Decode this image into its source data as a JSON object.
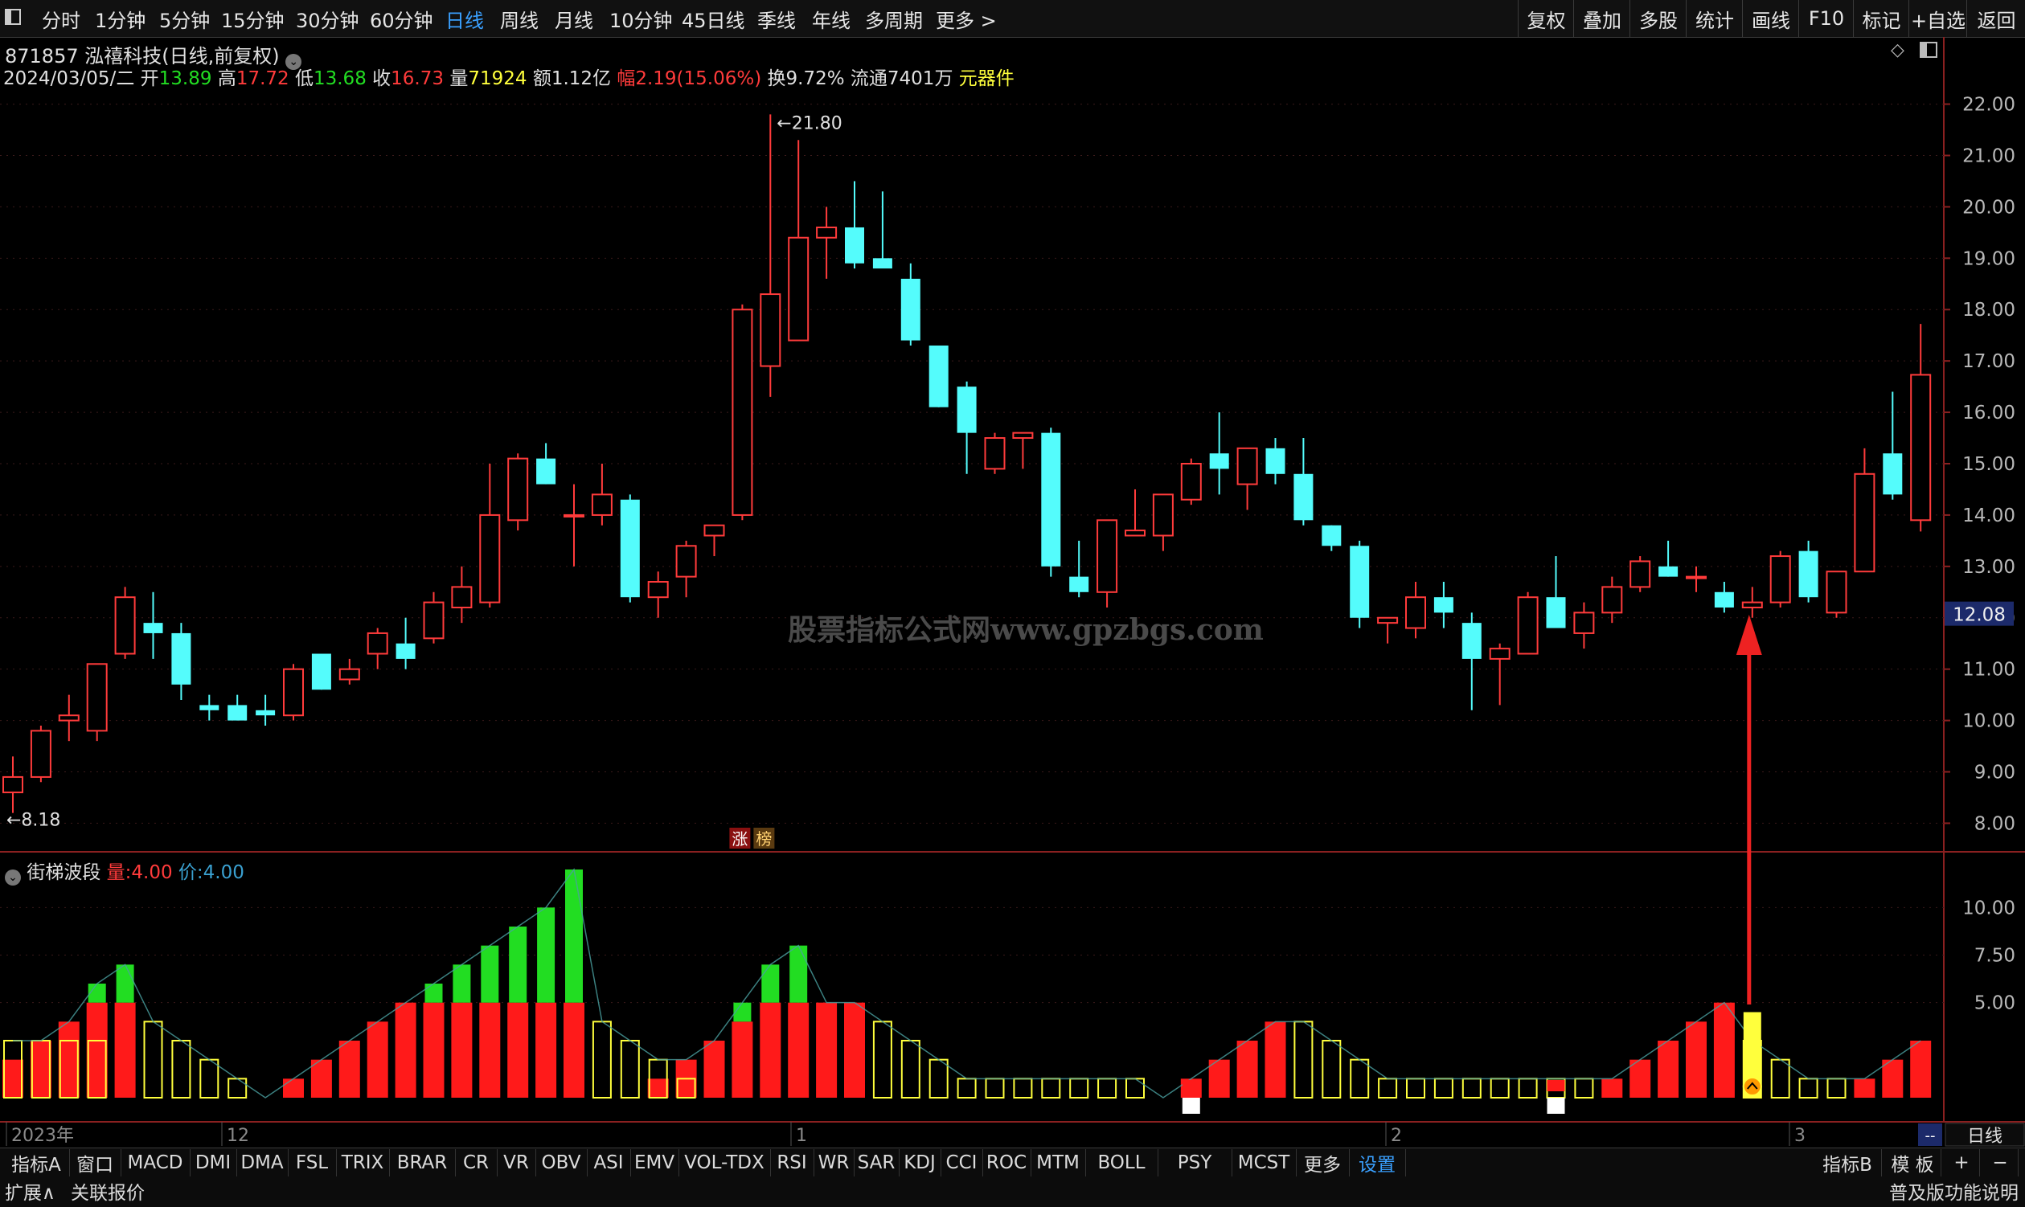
{
  "toolbar": {
    "timeframes": [
      "分时",
      "1分钟",
      "5分钟",
      "15分钟",
      "30分钟",
      "60分钟",
      "日线",
      "周线",
      "月线",
      "10分钟",
      "45日线",
      "季线",
      "年线",
      "多周期",
      "更多 >"
    ],
    "active_index": 6,
    "right_buttons": [
      "复权",
      "叠加",
      "多股",
      "统计",
      "画线",
      "F10",
      "标记",
      "+自选",
      "返回"
    ]
  },
  "stock": {
    "code_name": "871857 泓禧科技(日线,前复权)",
    "date": "2024/03/05/二",
    "open_label": "开",
    "open": "13.89",
    "high_label": "高",
    "high": "17.72",
    "low_label": "低",
    "low": "13.68",
    "close_label": "收",
    "close": "16.73",
    "vol_label": "量",
    "vol": "71924",
    "amount_label": "额",
    "amount": "1.12亿",
    "change_label": "幅",
    "change": "2.19(15.06%)",
    "turnover": "换9.72%",
    "float": "流通7401万",
    "sector": "元器件"
  },
  "price_axis": [
    "22.00",
    "21.00",
    "20.00",
    "19.00",
    "18.00",
    "17.00",
    "16.00",
    "15.00",
    "14.00",
    "13.00",
    "12.00",
    "11.00",
    "10.00",
    "9.00",
    "8.00"
  ],
  "current_price_tag": "12.08",
  "markers": {
    "max_label": "21.80",
    "min_label": "8.18",
    "zhang": "涨",
    "bang": "榜"
  },
  "watermark": "股票指标公式网www.gpzbgs.com",
  "indicator": {
    "name": "街梯波段",
    "vol_label": "量:",
    "vol_value": "4.00",
    "price_label": "价:",
    "price_value": "4.00",
    "axis": [
      "10.00",
      "7.50",
      "5.00"
    ]
  },
  "date_axis": [
    "2023年",
    "12",
    "1",
    "2",
    "3"
  ],
  "axis_minus": "--",
  "period_box": "日线",
  "tabs": [
    "指标A",
    "窗口",
    "MACD",
    "DMI",
    "DMA",
    "FSL",
    "TRIX",
    "BRAR",
    "CR",
    "VR",
    "OBV",
    "ASI",
    "EMV",
    "VOL-TDX",
    "RSI",
    "WR",
    "SAR",
    "KDJ",
    "CCI",
    "ROC",
    "MTM",
    "BOLL",
    "PSY",
    "MCST",
    "更多",
    "设置"
  ],
  "tabs_highlight": "设置",
  "tabs_right": [
    "指标B",
    "模 板",
    "+",
    "−"
  ],
  "bottom_left": [
    "扩展∧",
    "关联报价"
  ],
  "bottom_right": "普及版功能说明",
  "colors": {
    "up": "#ff3b3b",
    "down": "#54fcfc",
    "green": "#22dd22",
    "yellow": "#ffff3c",
    "accent": "#3aa0ff"
  },
  "chart_data": {
    "type": "candlestick",
    "candles": [
      [
        8.6,
        9.3,
        8.2,
        8.9
      ],
      [
        8.9,
        9.9,
        8.8,
        9.8
      ],
      [
        10.0,
        10.5,
        9.6,
        10.1
      ],
      [
        9.8,
        11.1,
        9.6,
        11.1
      ],
      [
        11.3,
        12.6,
        11.2,
        12.4
      ],
      [
        11.9,
        12.5,
        11.2,
        11.7
      ],
      [
        11.7,
        11.9,
        10.4,
        10.7
      ],
      [
        10.3,
        10.5,
        10.0,
        10.2
      ],
      [
        10.3,
        10.5,
        10.0,
        10.0
      ],
      [
        10.2,
        10.5,
        9.9,
        10.1
      ],
      [
        10.1,
        11.1,
        10.0,
        11.0
      ],
      [
        11.3,
        11.1,
        10.6,
        10.6
      ],
      [
        10.8,
        11.2,
        10.7,
        11.0
      ],
      [
        11.3,
        11.8,
        11.0,
        11.7
      ],
      [
        11.5,
        12.0,
        11.0,
        11.2
      ],
      [
        11.6,
        12.5,
        11.5,
        12.3
      ],
      [
        12.2,
        13.0,
        11.9,
        12.6
      ],
      [
        12.3,
        15.0,
        12.2,
        14.0
      ],
      [
        13.9,
        15.2,
        13.7,
        15.1
      ],
      [
        15.1,
        15.4,
        14.6,
        14.6
      ],
      [
        14.0,
        14.6,
        13.0,
        14.0
      ],
      [
        14.0,
        15.0,
        13.8,
        14.4
      ],
      [
        14.3,
        14.4,
        12.3,
        12.4
      ],
      [
        12.4,
        12.9,
        12.0,
        12.7
      ],
      [
        12.8,
        13.5,
        12.4,
        13.4
      ],
      [
        13.6,
        13.8,
        13.2,
        13.8
      ],
      [
        14.0,
        18.1,
        13.9,
        18.0
      ],
      [
        16.9,
        21.8,
        16.3,
        18.3
      ],
      [
        17.4,
        21.3,
        17.4,
        19.4
      ],
      [
        19.4,
        20.0,
        18.6,
        19.6
      ],
      [
        19.6,
        20.5,
        18.8,
        18.9
      ],
      [
        19.0,
        20.3,
        18.9,
        18.8
      ],
      [
        18.6,
        18.9,
        17.3,
        17.4
      ],
      [
        17.3,
        17.3,
        16.1,
        16.1
      ],
      [
        16.5,
        16.6,
        14.8,
        15.6
      ],
      [
        14.9,
        15.6,
        14.8,
        15.5
      ],
      [
        15.5,
        15.6,
        14.9,
        15.6
      ],
      [
        15.6,
        15.7,
        12.8,
        13.0
      ],
      [
        12.8,
        13.5,
        12.4,
        12.5
      ],
      [
        12.5,
        13.9,
        12.2,
        13.9
      ],
      [
        13.6,
        14.5,
        13.6,
        13.7
      ],
      [
        13.6,
        14.4,
        13.3,
        14.4
      ],
      [
        14.3,
        15.1,
        14.2,
        15.0
      ],
      [
        15.2,
        16.0,
        14.4,
        14.9
      ],
      [
        14.6,
        15.3,
        14.1,
        15.3
      ],
      [
        15.3,
        15.5,
        14.6,
        14.8
      ],
      [
        14.8,
        15.5,
        13.8,
        13.9
      ],
      [
        13.8,
        13.8,
        13.3,
        13.4
      ],
      [
        13.4,
        13.5,
        11.8,
        12.0
      ],
      [
        11.9,
        12.0,
        11.5,
        12.0
      ],
      [
        11.8,
        12.7,
        11.6,
        12.4
      ],
      [
        12.4,
        12.7,
        11.8,
        12.1
      ],
      [
        11.9,
        12.1,
        10.2,
        11.2
      ],
      [
        11.2,
        11.5,
        10.3,
        11.4
      ],
      [
        11.3,
        12.5,
        11.3,
        12.4
      ],
      [
        12.4,
        13.2,
        11.9,
        11.8
      ],
      [
        11.7,
        12.3,
        11.4,
        12.1
      ],
      [
        12.1,
        12.8,
        11.9,
        12.6
      ],
      [
        12.6,
        13.2,
        12.5,
        13.1
      ],
      [
        13.0,
        13.5,
        12.8,
        12.8
      ],
      [
        12.8,
        13.0,
        12.5,
        12.8
      ],
      [
        12.5,
        12.7,
        12.1,
        12.2
      ],
      [
        12.2,
        12.6,
        12.0,
        12.3
      ],
      [
        12.3,
        13.3,
        12.2,
        13.2
      ],
      [
        13.3,
        13.5,
        12.3,
        12.4
      ],
      [
        12.1,
        12.9,
        12.0,
        12.9
      ],
      [
        12.9,
        15.3,
        12.9,
        14.8
      ],
      [
        15.2,
        16.4,
        14.3,
        14.4
      ],
      [
        13.9,
        17.72,
        13.68,
        16.73
      ]
    ],
    "indicator_series": {
      "red": [
        2,
        3,
        4,
        5,
        5,
        0,
        0,
        0,
        0,
        0,
        1,
        2,
        3,
        4,
        5,
        5,
        5,
        5,
        5,
        5,
        5,
        0,
        0,
        1,
        2,
        3,
        4,
        5,
        5,
        5,
        5,
        0,
        0,
        0,
        0,
        0,
        0,
        0,
        0,
        0,
        0,
        0,
        1,
        2,
        3,
        4,
        0,
        0,
        0,
        0,
        0,
        0,
        0,
        0,
        0,
        0,
        0,
        1,
        2,
        3,
        4,
        5,
        0,
        0,
        0,
        0,
        1,
        2,
        3
      ],
      "yellow_outline": [
        3,
        3,
        3,
        3,
        0,
        4,
        3,
        2,
        1,
        0,
        0,
        0,
        0,
        0,
        0,
        0,
        0,
        0,
        0,
        0,
        0,
        4,
        3,
        2,
        1,
        0,
        0,
        0,
        0,
        0,
        0,
        4,
        3,
        2,
        1,
        1,
        1,
        1,
        1,
        1,
        1,
        0,
        0,
        0,
        0,
        0,
        4,
        3,
        2,
        1,
        1,
        1,
        1,
        1,
        1,
        1,
        1,
        0,
        0,
        0,
        0,
        0,
        3,
        2,
        1,
        1,
        0,
        0,
        0
      ],
      "green": [
        0,
        0,
        0,
        1,
        2,
        0,
        0,
        0,
        0,
        0,
        0,
        0,
        0,
        0,
        0,
        1,
        2,
        3,
        4,
        5,
        7,
        0,
        0,
        0,
        0,
        0,
        1,
        2,
        3,
        0,
        0,
        0,
        0,
        0,
        0,
        0,
        0,
        0,
        0,
        0,
        0,
        0,
        0,
        0,
        0,
        0,
        0,
        0,
        0,
        0,
        0,
        0,
        0,
        0,
        0,
        0,
        0,
        0,
        0,
        0,
        0,
        0,
        0,
        0,
        0,
        0,
        0,
        0,
        0
      ]
    },
    "signal_bar_index": 62,
    "ylim": [
      7.6,
      22.4
    ],
    "indicator_ylim": [
      0,
      12
    ]
  }
}
